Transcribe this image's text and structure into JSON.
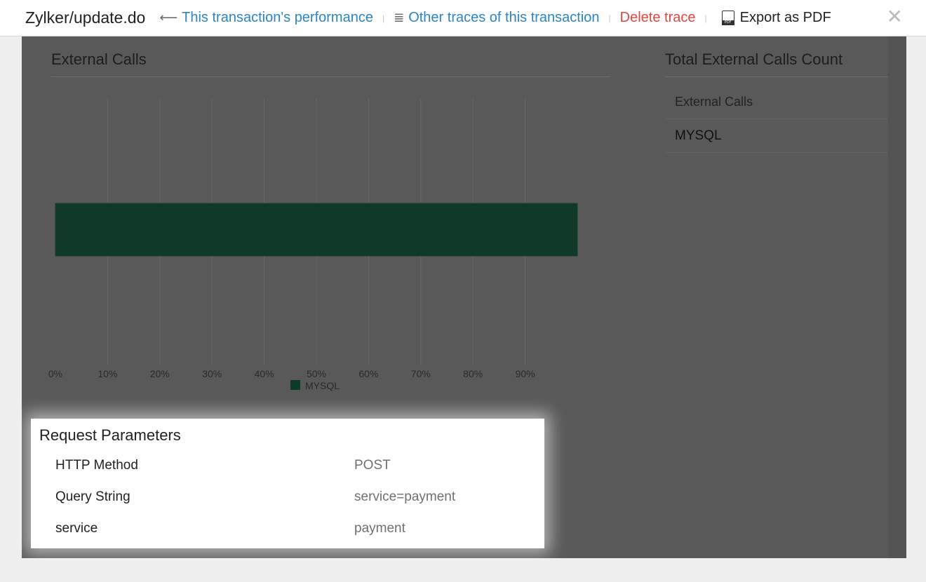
{
  "header": {
    "title": "Zylker/update.do",
    "perf_link": "This transaction's performance",
    "traces_link": "Other traces of this transaction",
    "delete_label": "Delete trace",
    "export_label": "Export as PDF",
    "close_glyph": "✕",
    "perf_icon": "arrow-left-icon",
    "traces_icon": "list-icon",
    "export_icon": "pdf-icon"
  },
  "external_calls": {
    "title": "External Calls"
  },
  "chart_data": {
    "type": "bar",
    "orientation": "horizontal",
    "categories": [
      "MYSQL"
    ],
    "series": [
      {
        "name": "MYSQL",
        "values": [
          100
        ],
        "color": "#0f3a28"
      }
    ],
    "xticks": [
      "0%",
      "10%",
      "20%",
      "30%",
      "40%",
      "50%",
      "60%",
      "70%",
      "80%",
      "90%"
    ],
    "xlim": [
      0,
      100
    ],
    "grid": true,
    "legend": "bottom-center",
    "title": "",
    "xlabel": "",
    "ylabel": ""
  },
  "total_calls": {
    "title": "Total External Calls Count",
    "header": "External Calls",
    "rows": [
      "MYSQL"
    ]
  },
  "request_params": {
    "title": "Request Parameters",
    "rows": [
      {
        "key": "HTTP Method",
        "value": "POST"
      },
      {
        "key": "Query String",
        "value": "service=payment"
      },
      {
        "key": "service",
        "value": "payment"
      }
    ]
  },
  "colors": {
    "link": "#2b85c8",
    "delete": "#e2473b",
    "overlay": "#595959",
    "bar": "#0f3a28"
  }
}
